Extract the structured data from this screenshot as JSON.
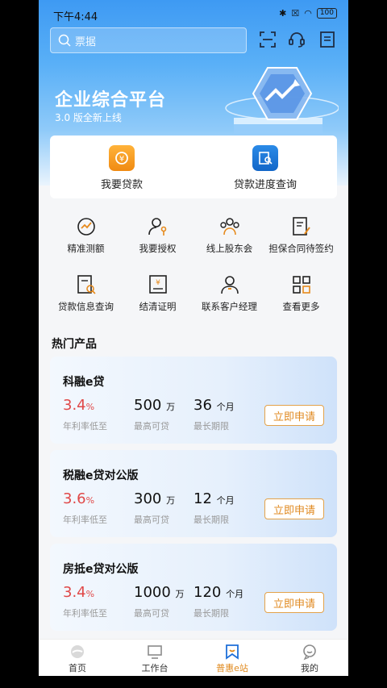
{
  "status": {
    "time": "下午4:44",
    "battery": "100"
  },
  "search": {
    "placeholder": "票据"
  },
  "banner": {
    "title": "企业综合平台",
    "subtitle": "3.0 版全新上线"
  },
  "quick": [
    {
      "label": "我要贷款"
    },
    {
      "label": "贷款进度查询"
    }
  ],
  "grid": [
    {
      "label": "精准测额",
      "icon": "gauge-icon"
    },
    {
      "label": "我要授权",
      "icon": "user-key-icon"
    },
    {
      "label": "线上股东会",
      "icon": "group-icon"
    },
    {
      "label": "担保合同待签约",
      "icon": "contract-sign-icon"
    },
    {
      "label": "贷款信息查询",
      "icon": "doc-search-icon"
    },
    {
      "label": "结清证明",
      "icon": "certificate-icon"
    },
    {
      "label": "联系客户经理",
      "icon": "manager-icon"
    },
    {
      "label": "查看更多",
      "icon": "grid-more-icon"
    }
  ],
  "hot_title": "热门产品",
  "products": [
    {
      "name": "科融e贷",
      "rate": "3.4",
      "rate_unit": "%",
      "rate_label": "年利率低至",
      "amount": "500",
      "amount_unit": "万",
      "amount_label": "最高可贷",
      "term": "36",
      "term_unit": "个月",
      "term_label": "最长期限",
      "button": "立即申请"
    },
    {
      "name": "税融e贷对公版",
      "rate": "3.6",
      "rate_unit": "%",
      "rate_label": "年利率低至",
      "amount": "300",
      "amount_unit": "万",
      "amount_label": "最高可贷",
      "term": "12",
      "term_unit": "个月",
      "term_label": "最长期限",
      "button": "立即申请"
    },
    {
      "name": "房抵e贷对公版",
      "rate": "3.4",
      "rate_unit": "%",
      "rate_label": "年利率低至",
      "amount": "1000",
      "amount_unit": "万",
      "amount_label": "最高可贷",
      "term": "120",
      "term_unit": "个月",
      "term_label": "最长期限",
      "button": "立即申请"
    }
  ],
  "tabs": [
    {
      "label": "首页"
    },
    {
      "label": "工作台"
    },
    {
      "label": "普惠e站",
      "active": true
    },
    {
      "label": "我的"
    }
  ],
  "colors": {
    "accent": "#e08a1e",
    "rate": "#e04848",
    "hero": "#3e9af3"
  }
}
